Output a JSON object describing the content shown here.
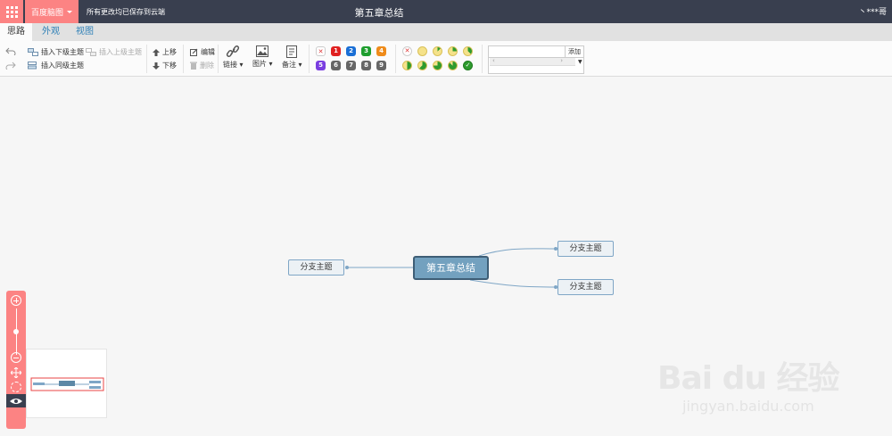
{
  "topbar": {
    "brand_label": "百度脑图",
    "save_status": "所有更改均已保存到云端",
    "document_title": "第五章总结",
    "user_name": "丶***哥"
  },
  "tabs": [
    {
      "label": "思路",
      "active": true
    },
    {
      "label": "外观",
      "active": false
    },
    {
      "label": "视图",
      "active": false
    }
  ],
  "toolbar": {
    "insert_child": "插入下级主题",
    "insert_parent": "插入上级主题",
    "insert_sibling": "插入同级主题",
    "move_up": "上移",
    "move_down": "下移",
    "edit": "编辑",
    "delete": "删除",
    "link": "链接",
    "image": "图片",
    "note": "备注",
    "priorities": [
      "1",
      "2",
      "3",
      "4",
      "5",
      "6",
      "7",
      "8",
      "9"
    ],
    "tag_add": "添加",
    "tag_placeholder": ""
  },
  "mindmap": {
    "root": "第五章总结",
    "left_branch": "分支主题",
    "right_branch_top": "分支主题",
    "right_branch_bottom": "分支主题"
  },
  "colors": {
    "topbar_bg": "#393f4f",
    "accent": "#fc8383",
    "root_node_bg": "#73a1bf",
    "sub_node_bg": "#ecf1f5"
  },
  "watermark": {
    "main": "Bai du 经验",
    "sub": "jingyan.baidu.com"
  }
}
